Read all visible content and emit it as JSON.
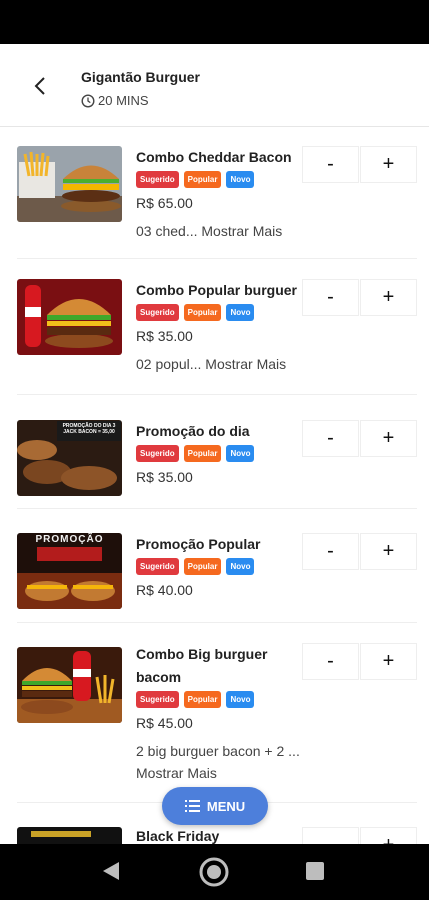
{
  "header": {
    "store_name": "Gigantão Burguer",
    "eta": "20 MINS"
  },
  "badges": {
    "suggested": "Sugerido",
    "popular": "Popular",
    "new": "Novo"
  },
  "stepper": {
    "minus": "-",
    "plus": "+"
  },
  "items": [
    {
      "name": "Combo Cheddar Bacon",
      "price": "R$ 65.00",
      "desc": "03 ched... Mostrar Mais"
    },
    {
      "name": "Combo Popular burguer",
      "price": "R$ 35.00",
      "desc": "02 popul... Mostrar Mais"
    },
    {
      "name": "Promoção do dia",
      "price": "R$ 35.00",
      "desc": "",
      "image_text": "PROMOÇÃO DO DIA 3 JACK BACON = 35,00"
    },
    {
      "name": "Promoção Popular",
      "price": "R$ 40.00",
      "desc": "",
      "image_text": "PROMOÇÃO"
    },
    {
      "name": "Combo Big burguer bacom",
      "price": "R$ 45.00",
      "desc": "2 big burguer bacon + 2 ... Mostrar Mais"
    },
    {
      "name": "Black Friday",
      "price": "",
      "desc": ""
    }
  ],
  "fab": {
    "label": "MENU"
  },
  "colors": {
    "badge_red": "#e03a3e",
    "badge_orange": "#f5691f",
    "badge_blue": "#2a8cf0",
    "fab": "#4d7fdb"
  }
}
